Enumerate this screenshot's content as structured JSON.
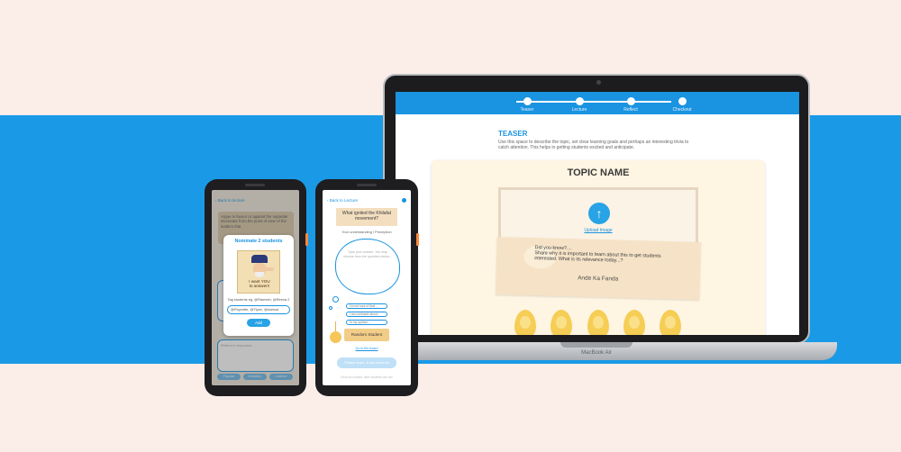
{
  "colors": {
    "accent": "#1a93e0",
    "band": "#1a9ae6",
    "background": "#fbeee9",
    "card": "#fff5e3",
    "egg": "#f6cd55"
  },
  "laptop": {
    "brand": "MacBook Air",
    "steps": [
      "Teaser",
      "Lecture",
      "Reflect",
      "Checkout"
    ],
    "teaser": {
      "title": "TEASER",
      "description": "Use this space to describe the topic, set clear learning goals and perhaps an interesting trivia to catch attention. This helps in getting students excited and anticipate."
    },
    "card": {
      "topic_name": "TOPIC NAME",
      "upload_icon": "arrow-up-icon",
      "upload_label": "Upload Image",
      "fact_line1": "Did you know?....",
      "fact_line2": "Share why it is important to learn about this to get students interested. What is its relevance today...?",
      "author": "Ande Ka Fanda",
      "egg_count": 5
    }
  },
  "phone1": {
    "back": "‹ Back to lecture",
    "bg_text": "Argue in favour or against the separate electorate from the point of view of the leaders that",
    "reflection_placeholder": "Reflect in response...",
    "bottom_buttons": [
      "Popular",
      "Invitation",
      "Listener"
    ],
    "modal": {
      "title": "Nominate 2 students",
      "poster_caption_1": "I want YOU",
      "poster_caption_2": "to answer!!",
      "tag_hint": "Tag students eg. @Ramesh, @Reena 2",
      "tag_value": "@Roycette, @Tiyan, @Aamod",
      "add_label": "Add"
    }
  },
  "phone2": {
    "back": "‹ Back to Lecture",
    "question": "What ignited the Khilafat movement?",
    "reception": "Your understanding / Perception",
    "cloud_placeholder": "Type your answer. You may choose from the question below...",
    "pills": [
      "I'm not sure of that...",
      "I am confused about...",
      "In my opinion..."
    ],
    "random_label": "Random Student",
    "listen_label": "Go to the board",
    "submit_label": "Please share, & ask students",
    "footnote": "Once you submit, other students can see"
  }
}
